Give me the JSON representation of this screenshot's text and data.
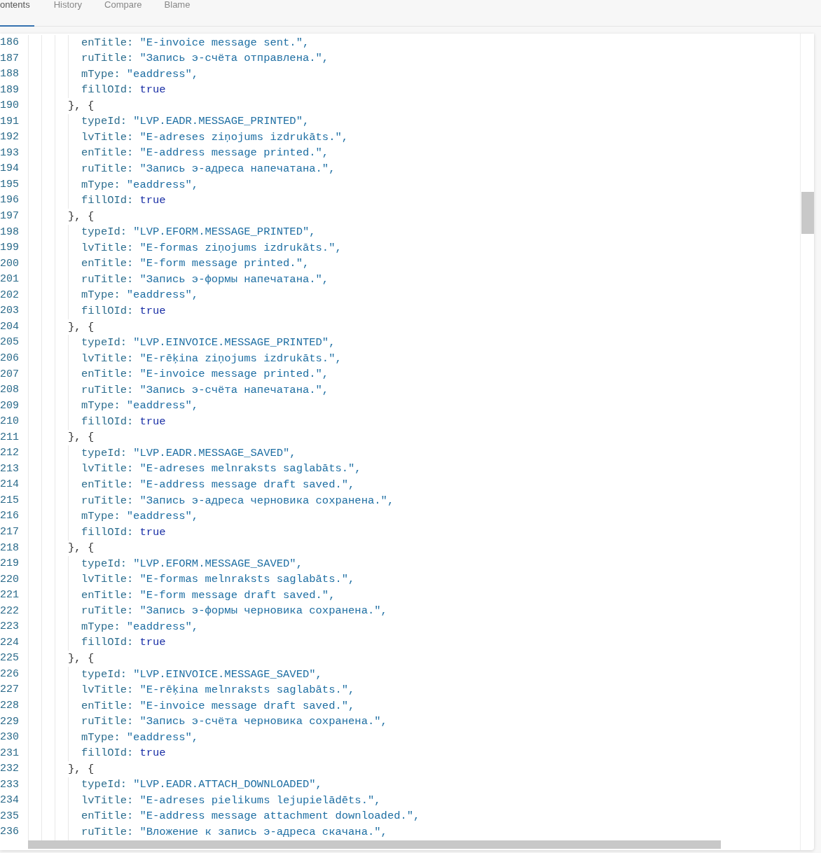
{
  "tabs": [
    {
      "label": "ontents",
      "selected": true
    },
    {
      "label": "History",
      "selected": false
    },
    {
      "label": "Compare",
      "selected": false
    },
    {
      "label": "Blame",
      "selected": false
    }
  ],
  "code_lines": [
    {
      "number": "186",
      "kind": "prop",
      "key": "enTitle:",
      "value": {
        "kind": "string",
        "text": "\"E-invoice message sent.\","
      }
    },
    {
      "number": "187",
      "kind": "prop",
      "key": "ruTitle:",
      "value": {
        "kind": "string",
        "text": "\"Запись э-счёта отправлена.\","
      }
    },
    {
      "number": "188",
      "kind": "prop",
      "key": "mType:",
      "value": {
        "kind": "string",
        "text": "\"eaddress\","
      }
    },
    {
      "number": "189",
      "kind": "prop",
      "key": "fillOId:",
      "value": {
        "kind": "keyword",
        "text": "true"
      }
    },
    {
      "number": "190",
      "kind": "brace",
      "text": "}, {"
    },
    {
      "number": "191",
      "kind": "prop",
      "key": "typeId:",
      "value": {
        "kind": "string",
        "text": "\"LVP.EADR.MESSAGE_PRINTED\","
      }
    },
    {
      "number": "192",
      "kind": "prop",
      "key": "lvTitle:",
      "value": {
        "kind": "string",
        "text": "\"E-adreses ziņojums izdrukāts.\","
      }
    },
    {
      "number": "193",
      "kind": "prop",
      "key": "enTitle:",
      "value": {
        "kind": "string",
        "text": "\"E-address message printed.\","
      }
    },
    {
      "number": "194",
      "kind": "prop",
      "key": "ruTitle:",
      "value": {
        "kind": "string",
        "text": "\"Запись э-адреса напечатана.\","
      }
    },
    {
      "number": "195",
      "kind": "prop",
      "key": "mType:",
      "value": {
        "kind": "string",
        "text": "\"eaddress\","
      }
    },
    {
      "number": "196",
      "kind": "prop",
      "key": "fillOId:",
      "value": {
        "kind": "keyword",
        "text": "true"
      }
    },
    {
      "number": "197",
      "kind": "brace",
      "text": "}, {"
    },
    {
      "number": "198",
      "kind": "prop",
      "key": "typeId:",
      "value": {
        "kind": "string",
        "text": "\"LVP.EFORM.MESSAGE_PRINTED\","
      }
    },
    {
      "number": "199",
      "kind": "prop",
      "key": "lvTitle:",
      "value": {
        "kind": "string",
        "text": "\"E-formas ziņojums izdrukāts.\","
      }
    },
    {
      "number": "200",
      "kind": "prop",
      "key": "enTitle:",
      "value": {
        "kind": "string",
        "text": "\"E-form message printed.\","
      }
    },
    {
      "number": "201",
      "kind": "prop",
      "key": "ruTitle:",
      "value": {
        "kind": "string",
        "text": "\"Запись э-формы напечатана.\","
      }
    },
    {
      "number": "202",
      "kind": "prop",
      "key": "mType:",
      "value": {
        "kind": "string",
        "text": "\"eaddress\","
      }
    },
    {
      "number": "203",
      "kind": "prop",
      "key": "fillOId:",
      "value": {
        "kind": "keyword",
        "text": "true"
      }
    },
    {
      "number": "204",
      "kind": "brace",
      "text": "}, {"
    },
    {
      "number": "205",
      "kind": "prop",
      "key": "typeId:",
      "value": {
        "kind": "string",
        "text": "\"LVP.EINVOICE.MESSAGE_PRINTED\","
      }
    },
    {
      "number": "206",
      "kind": "prop",
      "key": "lvTitle:",
      "value": {
        "kind": "string",
        "text": "\"E-rēķina ziņojums izdrukāts.\","
      }
    },
    {
      "number": "207",
      "kind": "prop",
      "key": "enTitle:",
      "value": {
        "kind": "string",
        "text": "\"E-invoice message printed.\","
      }
    },
    {
      "number": "208",
      "kind": "prop",
      "key": "ruTitle:",
      "value": {
        "kind": "string",
        "text": "\"Запись э-счёта напечатана.\","
      }
    },
    {
      "number": "209",
      "kind": "prop",
      "key": "mType:",
      "value": {
        "kind": "string",
        "text": "\"eaddress\","
      }
    },
    {
      "number": "210",
      "kind": "prop",
      "key": "fillOId:",
      "value": {
        "kind": "keyword",
        "text": "true"
      }
    },
    {
      "number": "211",
      "kind": "brace",
      "text": "}, {"
    },
    {
      "number": "212",
      "kind": "prop",
      "key": "typeId:",
      "value": {
        "kind": "string",
        "text": "\"LVP.EADR.MESSAGE_SAVED\","
      }
    },
    {
      "number": "213",
      "kind": "prop",
      "key": "lvTitle:",
      "value": {
        "kind": "string",
        "text": "\"E-adreses melnraksts saglabāts.\","
      }
    },
    {
      "number": "214",
      "kind": "prop",
      "key": "enTitle:",
      "value": {
        "kind": "string",
        "text": "\"E-address message draft saved.\","
      }
    },
    {
      "number": "215",
      "kind": "prop",
      "key": "ruTitle:",
      "value": {
        "kind": "string",
        "text": "\"Запись э-адреса черновика сохранена.\","
      }
    },
    {
      "number": "216",
      "kind": "prop",
      "key": "mType:",
      "value": {
        "kind": "string",
        "text": "\"eaddress\","
      }
    },
    {
      "number": "217",
      "kind": "prop",
      "key": "fillOId:",
      "value": {
        "kind": "keyword",
        "text": "true"
      }
    },
    {
      "number": "218",
      "kind": "brace",
      "text": "}, {"
    },
    {
      "number": "219",
      "kind": "prop",
      "key": "typeId:",
      "value": {
        "kind": "string",
        "text": "\"LVP.EFORM.MESSAGE_SAVED\","
      }
    },
    {
      "number": "220",
      "kind": "prop",
      "key": "lvTitle:",
      "value": {
        "kind": "string",
        "text": "\"E-formas melnraksts saglabāts.\","
      }
    },
    {
      "number": "221",
      "kind": "prop",
      "key": "enTitle:",
      "value": {
        "kind": "string",
        "text": "\"E-form message draft saved.\","
      }
    },
    {
      "number": "222",
      "kind": "prop",
      "key": "ruTitle:",
      "value": {
        "kind": "string",
        "text": "\"Запись э-формы черновика сохранена.\","
      }
    },
    {
      "number": "223",
      "kind": "prop",
      "key": "mType:",
      "value": {
        "kind": "string",
        "text": "\"eaddress\","
      }
    },
    {
      "number": "224",
      "kind": "prop",
      "key": "fillOId:",
      "value": {
        "kind": "keyword",
        "text": "true"
      }
    },
    {
      "number": "225",
      "kind": "brace",
      "text": "}, {"
    },
    {
      "number": "226",
      "kind": "prop",
      "key": "typeId:",
      "value": {
        "kind": "string",
        "text": "\"LVP.EINVOICE.MESSAGE_SAVED\","
      }
    },
    {
      "number": "227",
      "kind": "prop",
      "key": "lvTitle:",
      "value": {
        "kind": "string",
        "text": "\"E-rēķina melnraksts saglabāts.\","
      }
    },
    {
      "number": "228",
      "kind": "prop",
      "key": "enTitle:",
      "value": {
        "kind": "string",
        "text": "\"E-invoice message draft saved.\","
      }
    },
    {
      "number": "229",
      "kind": "prop",
      "key": "ruTitle:",
      "value": {
        "kind": "string",
        "text": "\"Запись э-счёта черновика сохранена.\","
      }
    },
    {
      "number": "230",
      "kind": "prop",
      "key": "mType:",
      "value": {
        "kind": "string",
        "text": "\"eaddress\","
      }
    },
    {
      "number": "231",
      "kind": "prop",
      "key": "fillOId:",
      "value": {
        "kind": "keyword",
        "text": "true"
      }
    },
    {
      "number": "232",
      "kind": "brace",
      "text": "}, {"
    },
    {
      "number": "233",
      "kind": "prop",
      "key": "typeId:",
      "value": {
        "kind": "string",
        "text": "\"LVP.EADR.ATTACH_DOWNLOADED\","
      }
    },
    {
      "number": "234",
      "kind": "prop",
      "key": "lvTitle:",
      "value": {
        "kind": "string",
        "text": "\"E-adreses pielikums lejupielādēts.\","
      }
    },
    {
      "number": "235",
      "kind": "prop",
      "key": "enTitle:",
      "value": {
        "kind": "string",
        "text": "\"E-address message attachment downloaded.\","
      }
    },
    {
      "number": "236",
      "kind": "prop",
      "key": "ruTitle:",
      "value": {
        "kind": "string",
        "text": "\"Вложение к запись э-адреса скачана.\","
      }
    }
  ]
}
